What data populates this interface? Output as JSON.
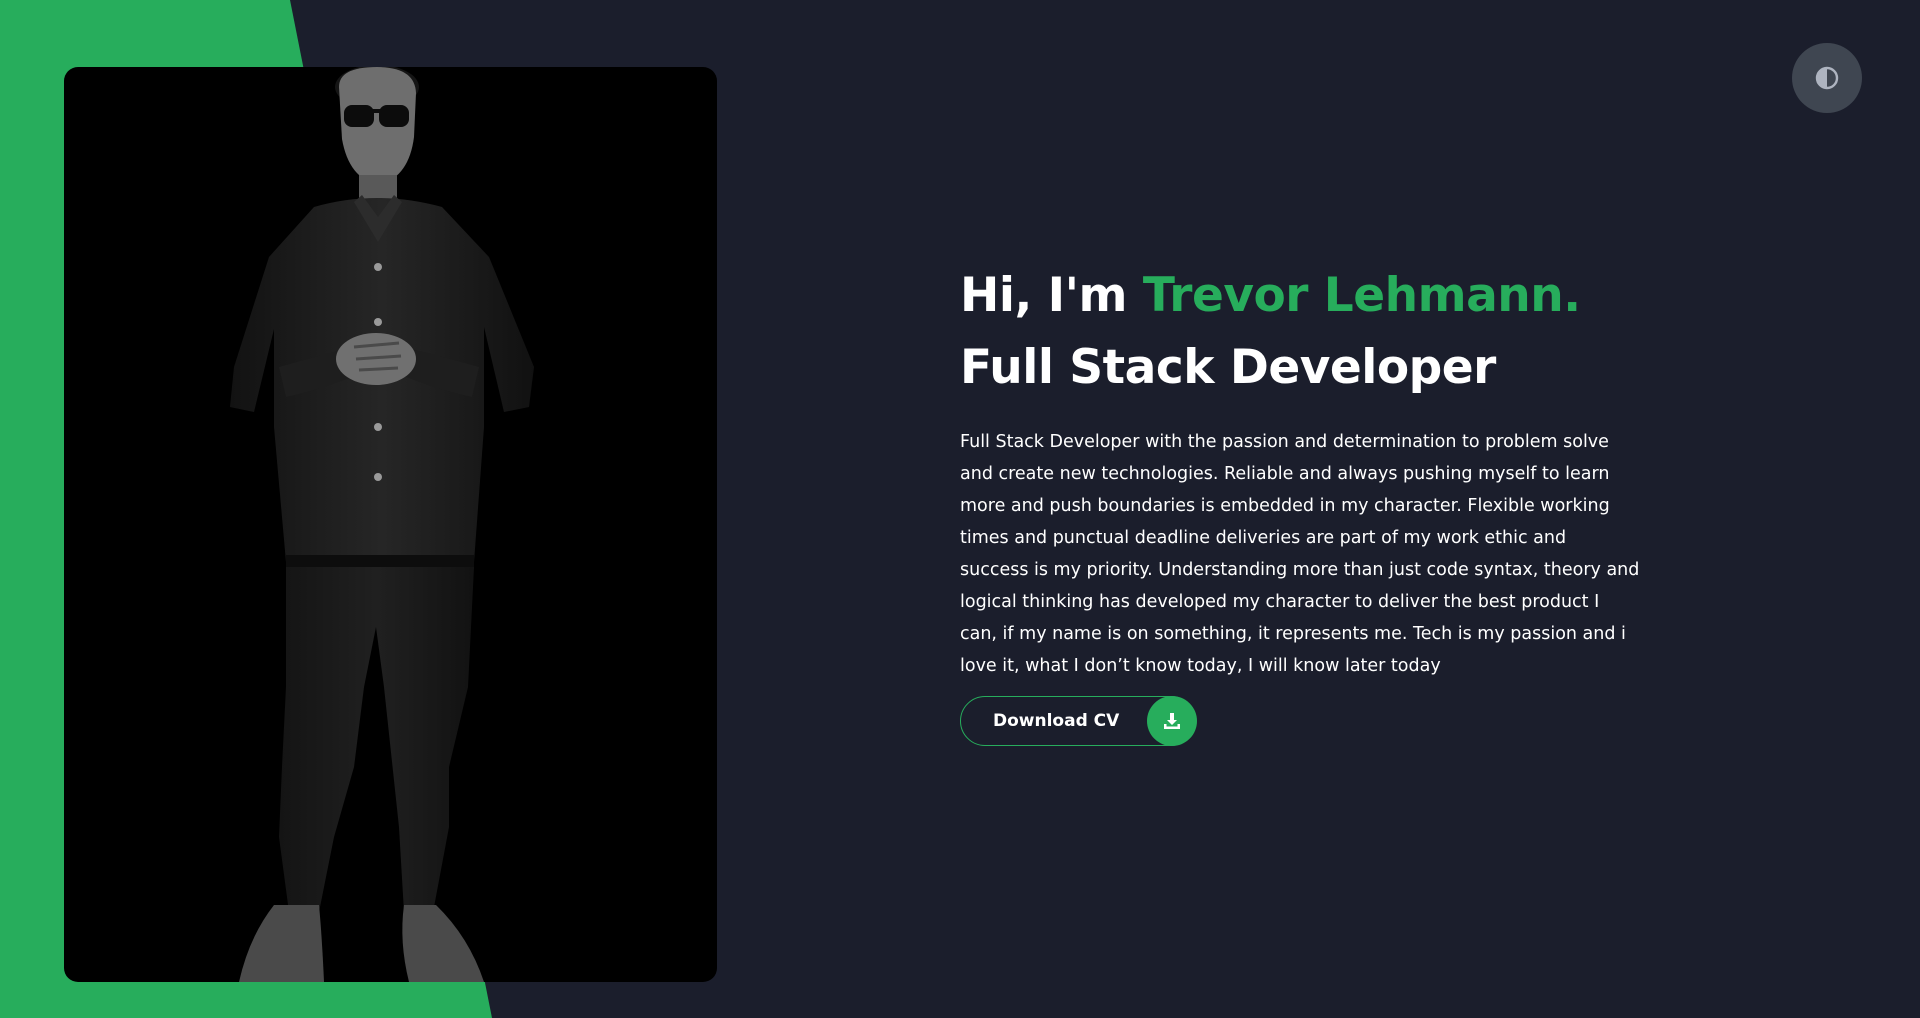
{
  "hero": {
    "greeting": "Hi, I'm ",
    "name": "Trevor Lehmann.",
    "role": "Full Stack Developer",
    "bio": "Full Stack Developer with the passion and determination to problem solve and create new technologies. Reliable and always pushing myself to learn more and push boundaries is embedded in my character. Flexible working times and punctual deadline deliveries are part of my work ethic and success is my priority. Understanding more than just code syntax, theory and logical thinking has developed my character to deliver the best product I can, if my name is on something, it represents me. Tech is my passion and i love it, what I don’t know today, I will know later today",
    "download_label": "Download CV",
    "download_icon": "download-icon"
  },
  "theme_toggle": {
    "icon": "contrast-icon"
  },
  "portrait": {
    "icon": "portrait-photo"
  },
  "colors": {
    "accent": "#27ad5c",
    "background": "#1b1e2c",
    "toggle_bg": "#3f4651",
    "text": "#ffffff"
  }
}
